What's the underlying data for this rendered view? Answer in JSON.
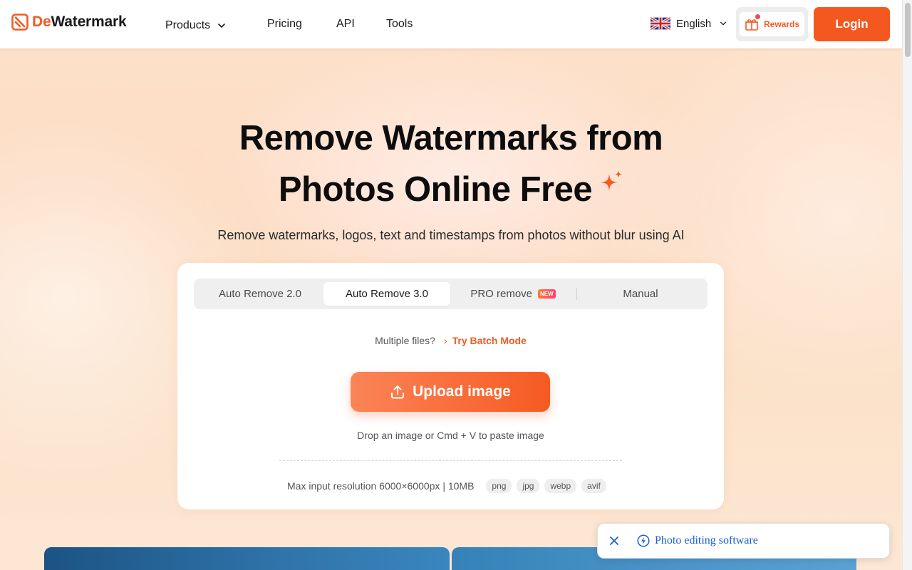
{
  "header": {
    "logo": {
      "prefix": "De",
      "rest": "Watermark"
    },
    "nav": {
      "products": "Products",
      "pricing": "Pricing",
      "api": "API",
      "tools": "Tools"
    },
    "language": {
      "label": "English",
      "flag_icon": "uk-flag-icon"
    },
    "rewards_label": "Rewards",
    "login_label": "Login"
  },
  "hero": {
    "title_line1": "Remove Watermarks from",
    "title_line2": "Photos Online Free",
    "subtitle": "Remove watermarks, logos, text and timestamps from photos without blur using AI"
  },
  "card": {
    "tabs": [
      {
        "label": "Auto Remove 2.0",
        "selected": false
      },
      {
        "label": "Auto Remove 3.0",
        "selected": true
      },
      {
        "label": "PRO remove",
        "selected": false,
        "badge": "NEW"
      },
      {
        "label": "Manual",
        "selected": false
      }
    ],
    "batch": {
      "question": "Multiple files?",
      "link": "Try Batch Mode"
    },
    "upload_label": "Upload image",
    "drop_hint": "Drop an image or Cmd + V to paste image",
    "limits": "Max input resolution 6000×6000px | 10MB",
    "formats": [
      "png",
      "jpg",
      "webp",
      "avif"
    ]
  },
  "toast": {
    "text": "Photo editing software"
  },
  "colors": {
    "accent": "#f45a22",
    "link_blue": "#1a5fd6"
  }
}
